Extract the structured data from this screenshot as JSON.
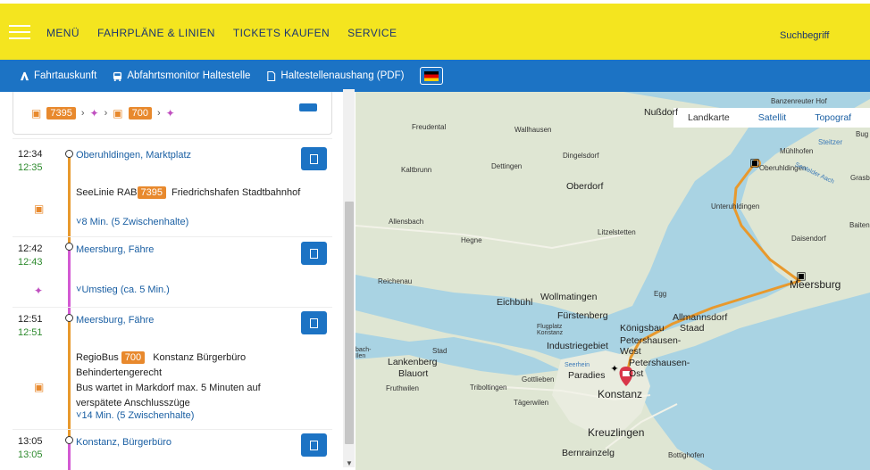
{
  "header": {
    "nav": [
      "MENÜ",
      "FAHRPLÄNE & LINIEN",
      "TICKETS KAUFEN",
      "SERVICE"
    ],
    "search_label": "Suchbegriff"
  },
  "subnav": {
    "items": [
      "Fahrtauskunft",
      "Abfahrtsmonitor Haltestelle",
      "Haltestellenaushang (PDF)"
    ],
    "language": "de"
  },
  "summary": {
    "badge1": "7395",
    "badge2": "700"
  },
  "legs": [
    {
      "dep": "12:34",
      "dep_rt": "12:35",
      "stop": "Oberuhldingen, Marktplatz",
      "line_prefix": "SeeLinie RAB",
      "line": "7395",
      "direction": "Friedrichshafen Stadtbahnhof",
      "detail": "8 Min. (5 Zwischenhalte)"
    },
    {
      "dep": "12:42",
      "dep_rt": "12:43",
      "stop": "Meersburg, Fähre",
      "detail": "Umstieg (ca. 5 Min.)"
    },
    {
      "dep": "12:51",
      "dep_rt": "12:51",
      "stop": "Meersburg, Fähre",
      "line_prefix": "RegioBus",
      "line": "700",
      "direction": "Konstanz Bürgerbüro",
      "notes": [
        "Behindertengerecht",
        "Bus wartet in Markdorf max. 5 Minuten auf",
        "verspätete Anschlusszüge"
      ],
      "detail": "14 Min. (5 Zwischenhalte)"
    },
    {
      "dep": "13:05",
      "dep_rt": "13:05",
      "stop": "Konstanz, Bürgerbüro"
    }
  ],
  "map": {
    "tabs": [
      "Landkarte",
      "Satellit",
      "Topograf"
    ],
    "colors": {
      "water": "#a9d3e3",
      "land": "#dfe6d3",
      "route": "#e8992d",
      "walk": "#c050c0"
    },
    "labels": [
      "Nußdorf",
      "Banzenreuter Hof",
      "Steitzer",
      "Mühlhofen",
      "Oberuhldingen",
      "Grasb",
      "Bug",
      "Freudental",
      "Wallhausen",
      "Dingelsdorf",
      "Kaltbrunn",
      "Dettingen",
      "Oberdorf",
      "Unteruhldingen",
      "Baiten",
      "Daisendorf",
      "Allensbach",
      "Hegne",
      "Litzelstetten",
      "Meersburg",
      "Reichenau",
      "Egg",
      "Eichbühl",
      "Wollmatingen",
      "Fürstenberg",
      "Königsbau",
      "Allmannsdorf",
      "Staad",
      "Flugplatz Konstanz",
      "Petershausen-West",
      "Industriegebiet",
      "Stad",
      "Lankenberg",
      "Blauort",
      "Paradies",
      "Petershausen-Ost",
      "Gottlieben",
      "Fruthwilen",
      "Triboltingen",
      "Konstanz",
      "Tägerwilen",
      "Kreuzlingen",
      "Bernrainzelg",
      "Bottighofen",
      "Seerhein",
      "Seefelder Aach",
      "bach-Ilen"
    ]
  }
}
